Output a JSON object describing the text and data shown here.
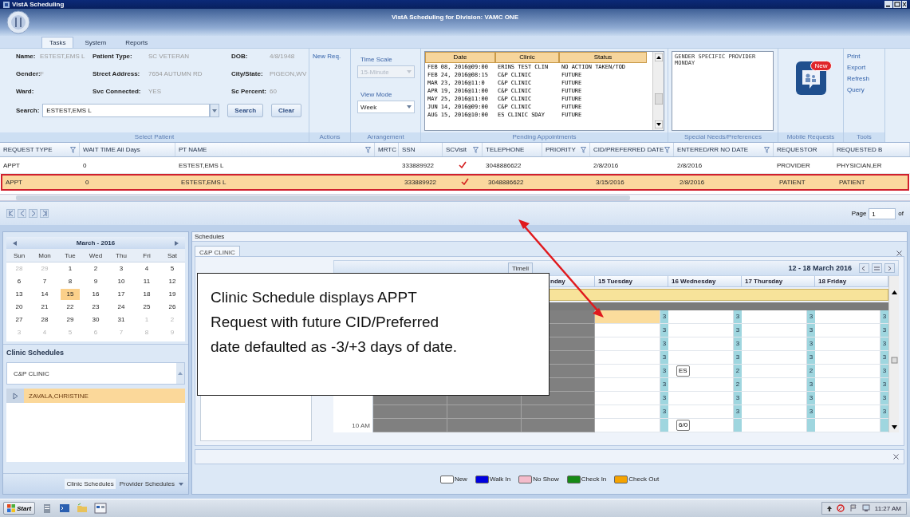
{
  "window": {
    "title": "VistA Scheduling",
    "subtitle": "VistA Scheduling for Division: VAMC ONE"
  },
  "ribbon_tabs": [
    {
      "label": "Tasks",
      "selected": true
    },
    {
      "label": "System",
      "selected": false
    },
    {
      "label": "Reports",
      "selected": false
    }
  ],
  "select_patient": {
    "group_label": "Select Patient",
    "fields": [
      {
        "label": "Name:",
        "value": "ESTEST,EMS L"
      },
      {
        "label": "Patient Type:",
        "value": "SC VETERAN"
      },
      {
        "label": "DOB:",
        "value": "4/8/1948"
      },
      {
        "label": "Gender:",
        "value": "F"
      },
      {
        "label": "Street Address:",
        "value": "7654 AUTUMN RD"
      },
      {
        "label": "City/State:",
        "value": "PIGEON,WV"
      },
      {
        "label": "Ward:"
      },
      {
        "label": "Svc Connected:",
        "value": "YES"
      },
      {
        "label": "Sc Percent:",
        "value": "60"
      }
    ],
    "search": {
      "label": "Search:",
      "value": "ESTEST,EMS L"
    },
    "buttons": [
      "Search",
      "Clear"
    ]
  },
  "actions": {
    "group_label": "Actions",
    "items": [
      "New Req."
    ]
  },
  "arrangement": {
    "group_label": "Arrangement",
    "time_scale": {
      "label": "Time Scale",
      "value": "15-Minute",
      "disabled": true
    },
    "view_mode": {
      "label": "View Mode",
      "value": "Week",
      "disabled": false
    }
  },
  "pending_appointments": {
    "group_label": "Pending Appointments",
    "columns": [
      "Date",
      "Clinic",
      "Status"
    ],
    "rows": [
      [
        "FEB 08, 2016@09:00",
        "ERINS TEST CLIN",
        "NO ACTION TAKEN/TOD"
      ],
      [
        "FEB 24, 2016@08:15",
        "C&P CLINIC",
        "FUTURE"
      ],
      [
        "MAR 23, 2016@11:0",
        "C&P CLINIC",
        "FUTURE"
      ],
      [
        "APR 19, 2016@11:00",
        "C&P CLINIC",
        "FUTURE"
      ],
      [
        "MAY 25, 2016@11:00",
        "C&P CLINIC",
        "FUTURE"
      ],
      [
        "JUN 14, 2016@09:00",
        "C&P CLINIC",
        "FUTURE"
      ],
      [
        "AUG 15, 2016@10:00",
        "ES CLINIC SDAY",
        "FUTURE"
      ]
    ]
  },
  "special_needs": {
    "group_label": "Special Needs/Preferences",
    "lines": [
      "GENDER SPECIFIC PROVIDER",
      "MONDAY"
    ]
  },
  "mobile_requests": {
    "group_label": "Mobile Requests",
    "badge": "New"
  },
  "tools": {
    "group_label": "Tools",
    "links": [
      "Print",
      "Export",
      "Refresh",
      "Query"
    ]
  },
  "request_grid": {
    "columns": [
      {
        "label": "REQUEST TYPE",
        "filter": true
      },
      {
        "label": "WAIT TIME All Days",
        "filter": false
      },
      {
        "label": "PT NAME",
        "filter": true
      },
      {
        "label": "MRTC",
        "filter": false
      },
      {
        "label": "SSN",
        "filter": false
      },
      {
        "label": "SCVisit",
        "filter": true
      },
      {
        "label": "TELEPHONE",
        "filter": false
      },
      {
        "label": "PRIORITY",
        "filter": true
      },
      {
        "label": "CID/PREFERRED DATE",
        "filter": true
      },
      {
        "label": "ENTERED/RR NO DATE",
        "filter": true
      },
      {
        "label": "REQUESTOR",
        "filter": false
      },
      {
        "label": "REQUESTED B",
        "filter": false
      }
    ],
    "rows": [
      {
        "cells": [
          "APPT",
          "0",
          "ESTEST,EMS L",
          null,
          "333889922",
          null,
          "3048886622",
          null,
          "2/8/2016",
          "2/8/2016",
          "PROVIDER",
          "PHYSICIAN,ER"
        ],
        "sc_visit": true,
        "selected": false
      },
      {
        "cells": [
          "APPT",
          "0",
          "ESTEST,EMS L",
          null,
          "333889922",
          null,
          "3048886622",
          null,
          "3/15/2016",
          "2/8/2016",
          "PATIENT",
          "PATIENT"
        ],
        "sc_visit": true,
        "selected": true
      }
    ],
    "pager": {
      "label": "Page",
      "value": "1",
      "suffix": "of"
    }
  },
  "calendar": {
    "title": "March - 2016",
    "weekdays": [
      "Sun",
      "Mon",
      "Tue",
      "Wed",
      "Thu",
      "Fri",
      "Sat"
    ],
    "weeks": [
      [
        {
          "day": "28",
          "other_month": true,
          "selected": false
        },
        {
          "day": "29",
          "other_month": true,
          "selected": false
        },
        {
          "day": "1",
          "other_month": false,
          "selected": false
        },
        {
          "day": "2",
          "other_month": false,
          "selected": false
        },
        {
          "day": "3",
          "other_month": false,
          "selected": false
        },
        {
          "day": "4",
          "other_month": false,
          "selected": false
        },
        {
          "day": "5",
          "other_month": false,
          "selected": false
        }
      ],
      [
        {
          "day": "6",
          "other_month": false,
          "selected": false
        },
        {
          "day": "7",
          "other_month": false,
          "selected": false
        },
        {
          "day": "8",
          "other_month": false,
          "selected": false
        },
        {
          "day": "9",
          "other_month": false,
          "selected": false
        },
        {
          "day": "10",
          "other_month": false,
          "selected": false
        },
        {
          "day": "11",
          "other_month": false,
          "selected": false
        },
        {
          "day": "12",
          "other_month": false,
          "selected": false
        }
      ],
      [
        {
          "day": "13",
          "other_month": false,
          "selected": false
        },
        {
          "day": "14",
          "other_month": false,
          "selected": false
        },
        {
          "day": "15",
          "other_month": false,
          "selected": true
        },
        {
          "day": "16",
          "other_month": false,
          "selected": false
        },
        {
          "day": "17",
          "other_month": false,
          "selected": false
        },
        {
          "day": "18",
          "other_month": false,
          "selected": false
        },
        {
          "day": "19",
          "other_month": false,
          "selected": false
        }
      ],
      [
        {
          "day": "20",
          "other_month": false,
          "selected": false
        },
        {
          "day": "21",
          "other_month": false,
          "selected": false
        },
        {
          "day": "22",
          "other_month": false,
          "selected": false
        },
        {
          "day": "23",
          "other_month": false,
          "selected": false
        },
        {
          "day": "24",
          "other_month": false,
          "selected": false
        },
        {
          "day": "25",
          "other_month": false,
          "selected": false
        },
        {
          "day": "26",
          "other_month": false,
          "selected": false
        }
      ],
      [
        {
          "day": "27",
          "other_month": false,
          "selected": false
        },
        {
          "day": "28",
          "other_month": false,
          "selected": false
        },
        {
          "day": "29",
          "other_month": false,
          "selected": false
        },
        {
          "day": "30",
          "other_month": false,
          "selected": false
        },
        {
          "day": "31",
          "other_month": false,
          "selected": false
        },
        {
          "day": "1",
          "other_month": true,
          "selected": false
        },
        {
          "day": "2",
          "other_month": true,
          "selected": false
        }
      ],
      [
        {
          "day": "3",
          "other_month": true,
          "selected": false
        },
        {
          "day": "4",
          "other_month": true,
          "selected": false
        },
        {
          "day": "5",
          "other_month": true,
          "selected": false
        },
        {
          "day": "6",
          "other_month": true,
          "selected": false
        },
        {
          "day": "7",
          "other_month": true,
          "selected": false
        },
        {
          "day": "8",
          "other_month": true,
          "selected": false
        },
        {
          "day": "9",
          "other_month": true,
          "selected": false
        }
      ]
    ]
  },
  "clinic_schedules": {
    "title": "Clinic Schedules",
    "clinic": "C&P CLINIC",
    "providers": [
      {
        "name": "ZAVALA,CHRISTINE",
        "selected": true
      }
    ],
    "footer_tabs": [
      {
        "label": "Clinic Schedules",
        "selected": true
      },
      {
        "label": "Provider Schedules",
        "selected": false
      }
    ]
  },
  "schedules": {
    "title": "Schedules",
    "tabs": [
      {
        "label": "C&P CLINIC",
        "selected": true
      }
    ],
    "view_tab": "Timeli",
    "range": "12 - 18 March 2016",
    "partial_day": "nday",
    "days": [
      "15 Tuesday",
      "16 Wednesday",
      "17 Thursday",
      "18 Friday"
    ],
    "slots": [
      {
        "cells": [
          {
            "count": "3",
            "selected": true
          },
          {
            "count": "3",
            "selected": false
          },
          {
            "count": "3",
            "selected": false
          },
          {
            "count": "3",
            "selected": false
          }
        ]
      },
      {
        "cells": [
          {
            "count": "3",
            "selected": false
          },
          {
            "count": "3",
            "selected": false
          },
          {
            "count": "3",
            "selected": false
          },
          {
            "count": "3",
            "selected": false
          }
        ]
      },
      {
        "cells": [
          {
            "count": "3",
            "selected": false
          },
          {
            "count": "3",
            "selected": false
          },
          {
            "count": "3",
            "selected": false
          },
          {
            "count": "3",
            "selected": false
          }
        ]
      },
      {
        "cells": [
          {
            "count": "3",
            "selected": false
          },
          {
            "count": "3",
            "selected": false
          },
          {
            "count": "3",
            "selected": false
          },
          {
            "count": "3",
            "selected": false
          }
        ]
      },
      {
        "cells": [
          {
            "count": "3",
            "selected": false
          },
          {
            "count": "2",
            "selected": false,
            "appointment": "ES"
          },
          {
            "count": "2",
            "selected": false
          },
          {
            "count": "3",
            "selected": false
          }
        ]
      },
      {
        "cells": [
          {
            "count": "3",
            "selected": false
          },
          {
            "count": "2",
            "selected": false
          },
          {
            "count": "3",
            "selected": false
          },
          {
            "count": "3",
            "selected": false
          }
        ]
      },
      {
        "cells": [
          {
            "count": "3",
            "selected": false
          },
          {
            "count": "3",
            "selected": false
          },
          {
            "count": "3",
            "selected": false
          },
          {
            "count": "3",
            "selected": false
          }
        ]
      },
      {
        "cells": [
          {
            "count": "3",
            "selected": false
          },
          {
            "count": "3",
            "selected": false
          },
          {
            "count": "3",
            "selected": false
          },
          {
            "count": "3",
            "selected": false
          }
        ]
      },
      {
        "time": "10 AM",
        "cells": [
          {
            "selected": false
          },
          {
            "selected": false,
            "appointment": "6/0"
          },
          {
            "selected": false
          },
          {
            "selected": false
          }
        ]
      }
    ]
  },
  "legend": [
    {
      "label": "New",
      "color": "#ffffff"
    },
    {
      "label": "Walk In",
      "color": "#0000e0"
    },
    {
      "label": "No Show",
      "color": "#f4bccb"
    },
    {
      "label": "Check In",
      "color": "#168a16"
    },
    {
      "label": "Check Out",
      "color": "#f5a300"
    }
  ],
  "callout": {
    "text": "Clinic Schedule displays APPT Request with future CID/Preferred date defaulted as -3/+3 days of date."
  },
  "taskbar": {
    "start": "Start",
    "clock": "11:27 AM"
  }
}
